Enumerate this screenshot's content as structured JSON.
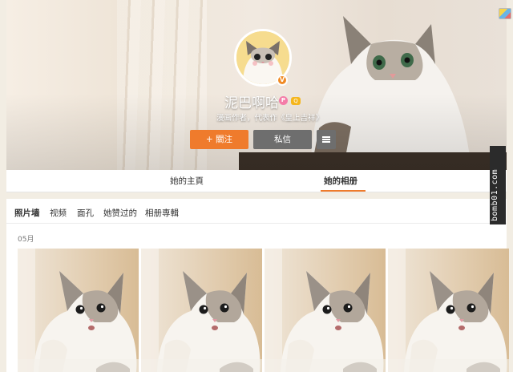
{
  "profile": {
    "name": "泥巴啊哈",
    "badge_p": "P",
    "badge_y": "Q",
    "verified_badge": "V",
    "description": "漫画作者，代表作《皇上吉祥》"
  },
  "actions": {
    "follow_label": "+ 關注",
    "message_label": "私信",
    "more_icon": "menu-icon"
  },
  "tabs": [
    {
      "label": "她的主頁",
      "active": false
    },
    {
      "label": "她的相册",
      "active": true
    }
  ],
  "album_nav": [
    "照片墙",
    "视频",
    "面孔",
    "她赞过的",
    "相册専輯"
  ],
  "month_label": "05月",
  "photos": [
    {
      "alt": "cat-photo-1"
    },
    {
      "alt": "cat-photo-2"
    },
    {
      "alt": "cat-photo-3"
    },
    {
      "alt": "cat-photo-4"
    }
  ],
  "watermark": "bomb01.com",
  "colors": {
    "accent": "#ef7b2c",
    "button_dark": "#6e6e6e"
  }
}
